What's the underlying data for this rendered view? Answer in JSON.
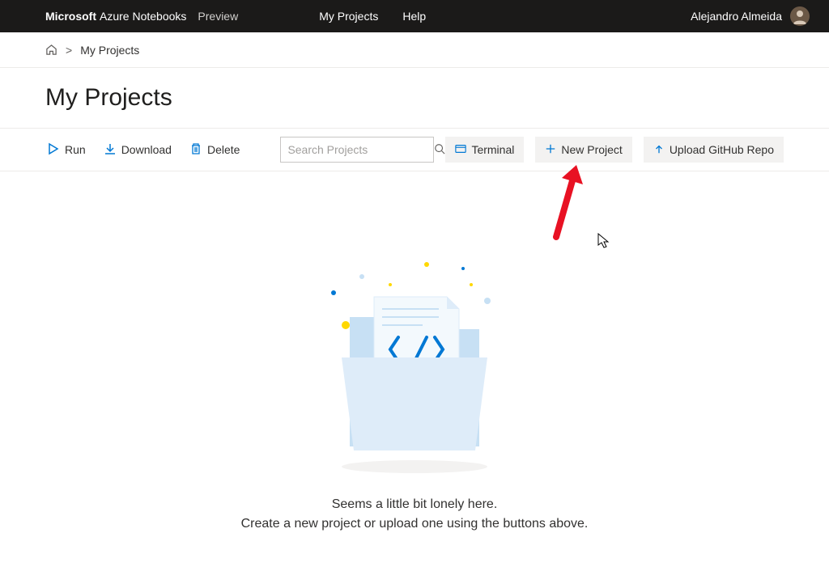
{
  "header": {
    "brand_bold": "Microsoft",
    "brand_rest": "Azure Notebooks",
    "preview": "Preview",
    "nav": {
      "my_projects": "My Projects",
      "help": "Help"
    },
    "user_name": "Alejandro Almeida"
  },
  "breadcrumb": {
    "current": "My Projects"
  },
  "page": {
    "title": "My Projects"
  },
  "toolbar": {
    "run": "Run",
    "download": "Download",
    "delete": "Delete",
    "search_placeholder": "Search Projects",
    "terminal": "Terminal",
    "new_project": "New Project",
    "upload_repo": "Upload GitHub Repo"
  },
  "empty": {
    "line1": "Seems a little bit lonely here.",
    "line2": "Create a new project or upload one using the buttons above."
  }
}
